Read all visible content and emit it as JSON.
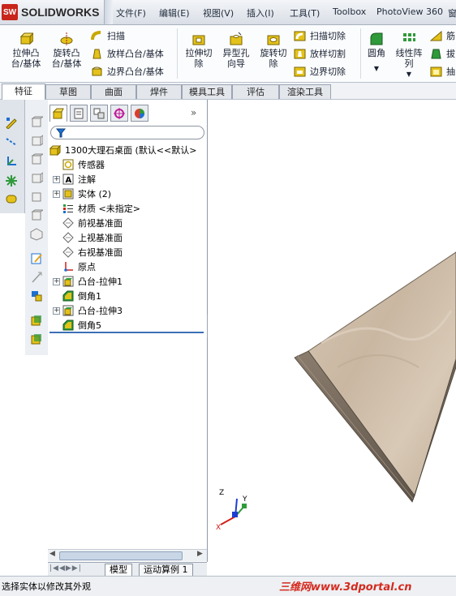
{
  "app": {
    "logo_mark": "SW",
    "name": "SOLIDWORKS"
  },
  "menu": [
    "文件(F)",
    "编辑(E)",
    "视图(V)",
    "插入(I)",
    "工具(T)",
    "Toolbox",
    "PhotoView 360",
    "窗"
  ],
  "ribbon": {
    "extrude_boss": "拉伸凸\n台/基体",
    "revolve_boss": "旋转凸\n台/基体",
    "sweep": "扫描",
    "loft_boss": "放样凸台/基体",
    "boundary_boss": "边界凸台/基体",
    "extrude_cut": "拉伸切\n除",
    "hole_wizard": "异型孔\n向导",
    "revolve_cut": "旋转切\n除",
    "sweep_cut": "扫描切除",
    "loft_cut": "放样切割",
    "boundary_cut": "边界切除",
    "fillet": "圆角",
    "linear_pattern": "线性阵\n列",
    "rib": "筋",
    "draft": "拔",
    "shell": "抽"
  },
  "tabs": [
    "特征",
    "草图",
    "曲面",
    "焊件",
    "模具工具",
    "评估",
    "渲染工具"
  ],
  "tree": {
    "root": "1300大理石桌面   (默认<<默认>",
    "items": [
      {
        "label": "传感器",
        "expandable": false,
        "icon": "sensor-icon"
      },
      {
        "label": "注解",
        "expandable": true,
        "icon": "annotation-icon"
      },
      {
        "label": "实体 (2)",
        "expandable": true,
        "icon": "solid-bodies-icon"
      },
      {
        "label": "材质 <未指定>",
        "expandable": false,
        "icon": "material-icon"
      },
      {
        "label": "前视基准面",
        "expandable": false,
        "icon": "plane-icon"
      },
      {
        "label": "上视基准面",
        "expandable": false,
        "icon": "plane-icon"
      },
      {
        "label": "右视基准面",
        "expandable": false,
        "icon": "plane-icon"
      },
      {
        "label": "原点",
        "expandable": false,
        "icon": "origin-icon"
      },
      {
        "label": "凸台-拉伸1",
        "expandable": true,
        "icon": "boss-extrude-icon"
      },
      {
        "label": "倒角1",
        "expandable": false,
        "icon": "chamfer-icon"
      },
      {
        "label": "凸台-拉伸3",
        "expandable": true,
        "icon": "boss-extrude-icon"
      },
      {
        "label": "倒角5",
        "expandable": false,
        "icon": "chamfer-icon"
      }
    ]
  },
  "bottom_tabs": [
    "模型",
    "运动算例 1"
  ],
  "triad": {
    "x": "X",
    "y": "Y",
    "z": "Z"
  },
  "status": "选择实体以修改其外观",
  "watermark": "三维网www.3dportal.cn",
  "colors": {
    "accent": "#c8251b",
    "marble": "#c9b7a2",
    "marble_edge": "#7a6e60",
    "tree_select": "#3b6fb6"
  }
}
